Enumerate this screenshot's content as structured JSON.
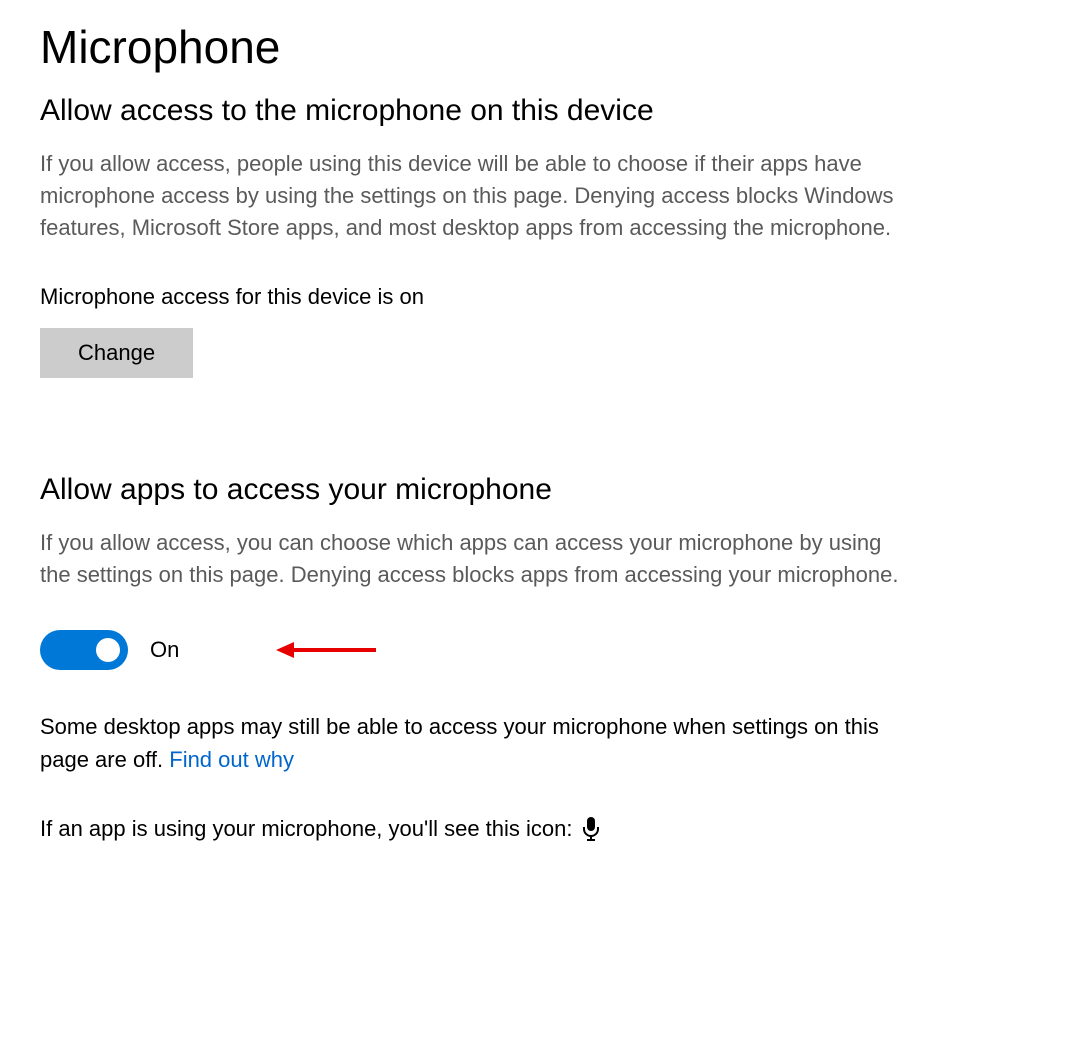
{
  "page": {
    "title": "Microphone"
  },
  "section1": {
    "heading": "Allow access to the microphone on this device",
    "description": "If you allow access, people using this device will be able to choose if their apps have microphone access by using the settings on this page. Denying access blocks Windows features, Microsoft Store apps, and most desktop apps from accessing the microphone.",
    "status": "Microphone access for this device is on",
    "button": "Change"
  },
  "section2": {
    "heading": "Allow apps to access your microphone",
    "description": "If you allow access, you can choose which apps can access your microphone by using the settings on this page. Denying access blocks apps from accessing your microphone.",
    "toggle_state": "On",
    "note_text": "Some desktop apps may still be able to access your microphone when settings on this page are off. ",
    "note_link": "Find out why",
    "icon_line": "If an app is using your microphone, you'll see this icon:"
  }
}
